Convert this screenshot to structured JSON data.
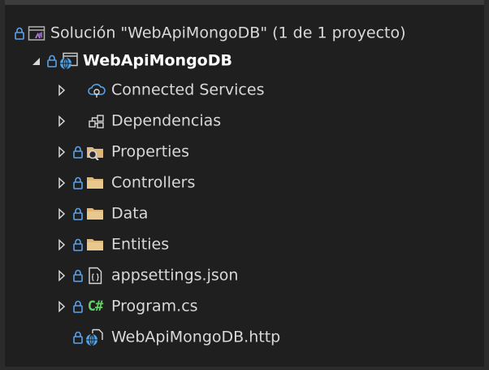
{
  "solution": {
    "label": "Solución \"WebApiMongoDB\"  (1 de 1 proyecto)",
    "icon": "solution-icon"
  },
  "project": {
    "label": "WebApiMongoDB",
    "icon": "web-project-icon",
    "expanded": true
  },
  "items": [
    {
      "label": "Connected Services",
      "icon": "connected-services-icon",
      "locked": false,
      "expandable": true
    },
    {
      "label": "Dependencias",
      "icon": "dependencies-icon",
      "locked": false,
      "expandable": true
    },
    {
      "label": "Properties",
      "icon": "properties-folder-icon",
      "locked": true,
      "expandable": true
    },
    {
      "label": "Controllers",
      "icon": "folder-icon",
      "locked": true,
      "expandable": true
    },
    {
      "label": "Data",
      "icon": "folder-icon",
      "locked": true,
      "expandable": true
    },
    {
      "label": "Entities",
      "icon": "folder-icon",
      "locked": true,
      "expandable": true
    },
    {
      "label": "appsettings.json",
      "icon": "json-file-icon",
      "locked": true,
      "expandable": true
    },
    {
      "label": "Program.cs",
      "icon": "csharp-file-icon",
      "icon_text": "C#",
      "locked": true,
      "expandable": true
    },
    {
      "label": "WebApiMongoDB.http",
      "icon": "http-file-icon",
      "locked": true,
      "expandable": false
    }
  ],
  "colors": {
    "background": "#1f1f1f",
    "text": "#d8d8d8",
    "lock": "#5aa2e8",
    "folder": "#dcb67a",
    "csharp": "#5fd35f",
    "globe": "#4fa6ec"
  }
}
